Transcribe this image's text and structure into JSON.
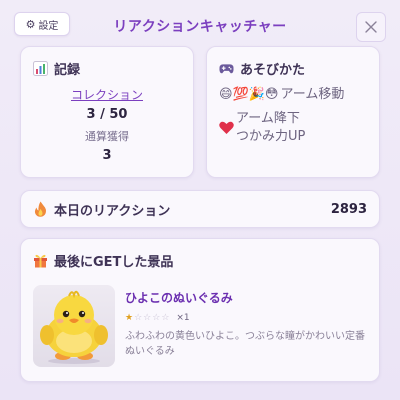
{
  "app": {
    "title": "リアクションキャッチャー"
  },
  "header": {
    "settings_label": "設定"
  },
  "records": {
    "title": "記録",
    "collection_label": "コレクション",
    "collection_value": "3 / 50",
    "total_label": "通算獲得",
    "total_value": "3"
  },
  "howto": {
    "title": "あそびかた",
    "move_emojis": "😄💯🎉😳",
    "move_text": "アーム移動",
    "drop_emoji": "❤️",
    "drop_text": "アーム降下",
    "grab_text": "つかみ力UP"
  },
  "reactions": {
    "label": "本日のリアクション",
    "count": "2893"
  },
  "prize": {
    "title": "最後にGETした景品",
    "name": "ひよこのぬいぐるみ",
    "rating": 1,
    "rating_max": 5,
    "quantity": "×1",
    "description": "ふわふわの黄色いひよこ。つぶらな瞳がかわいい定番ぬいぐるみ"
  },
  "icons": {
    "settings": "gear-icon",
    "close": "close-icon",
    "records": "bar-chart-icon",
    "howto": "game-controller-icon",
    "reactions": "fire-icon",
    "prize": "gift-icon"
  },
  "colors": {
    "accent": "#7b3fbf",
    "background": "#ede7f6",
    "star": "#e0a020"
  }
}
